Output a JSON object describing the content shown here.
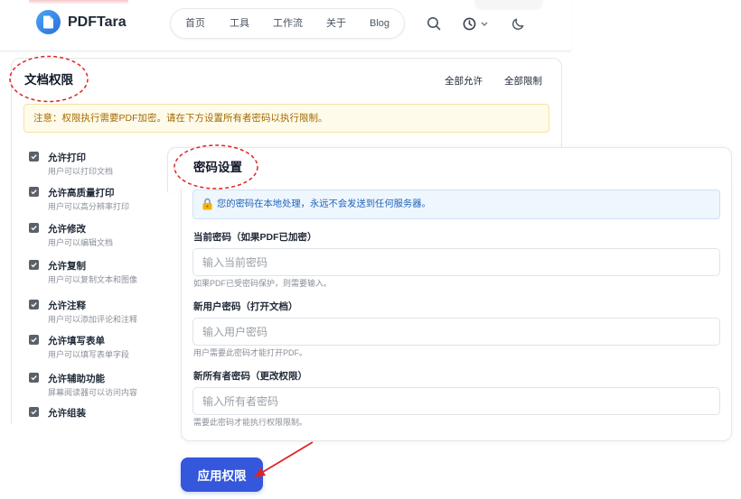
{
  "header": {
    "brand": "PDFTara",
    "nav": [
      "首页",
      "工具",
      "工作流",
      "关于",
      "Blog"
    ]
  },
  "icons": {
    "logo": "document-icon",
    "search": "search-icon",
    "history": "clock-icon",
    "history_menu": "chevron-down-icon",
    "theme_toggle": "moon-icon",
    "checkbox": "check-icon",
    "info": "lock-icon"
  },
  "permissions": {
    "title": "文档权限",
    "allow_all": "全部允许",
    "restrict_all": "全部限制",
    "notice": "注意：权限执行需要PDF加密。请在下方设置所有者密码以执行限制。",
    "items": [
      {
        "label": "允许打印",
        "desc": "用户可以打印文档",
        "checked": true
      },
      {
        "label": "允许高质量打印",
        "desc": "用户可以高分辨率打印",
        "checked": true
      },
      {
        "label": "允许修改",
        "desc": "用户可以编辑文档",
        "checked": true
      },
      {
        "label": "允许复制",
        "desc": "用户可以复制文本和图像",
        "checked": true
      },
      {
        "label": "允许注释",
        "desc": "用户可以添加评论和注释",
        "checked": true
      },
      {
        "label": "允许填写表单",
        "desc": "用户可以填写表单字段",
        "checked": true
      },
      {
        "label": "允许辅助功能",
        "desc": "屏幕阅读器可以访问内容",
        "checked": true
      },
      {
        "label": "允许组装",
        "checked": true
      }
    ]
  },
  "password": {
    "title": "密码设置",
    "info": "您的密码在本地处理，永远不会发送到任何服务器。",
    "fields": [
      {
        "label": "当前密码（如果PDF已加密）",
        "placeholder": "输入当前密码",
        "hint": "如果PDF已受密码保护，则需要输入。"
      },
      {
        "label": "新用户密码（打开文档）",
        "placeholder": "输入用户密码",
        "hint": "用户需要此密码才能打开PDF。"
      },
      {
        "label": "新所有者密码（更改权限）",
        "placeholder": "输入所有者密码",
        "hint": "需要此密码才能执行权限限制。"
      }
    ]
  },
  "apply_button": "应用权限",
  "theme": {
    "primary": "#3457dc",
    "brand_blue": "#2a6edf",
    "notice_text": "#a36a00",
    "info_text": "#1f62b8",
    "annotation_red": "#e02424"
  }
}
